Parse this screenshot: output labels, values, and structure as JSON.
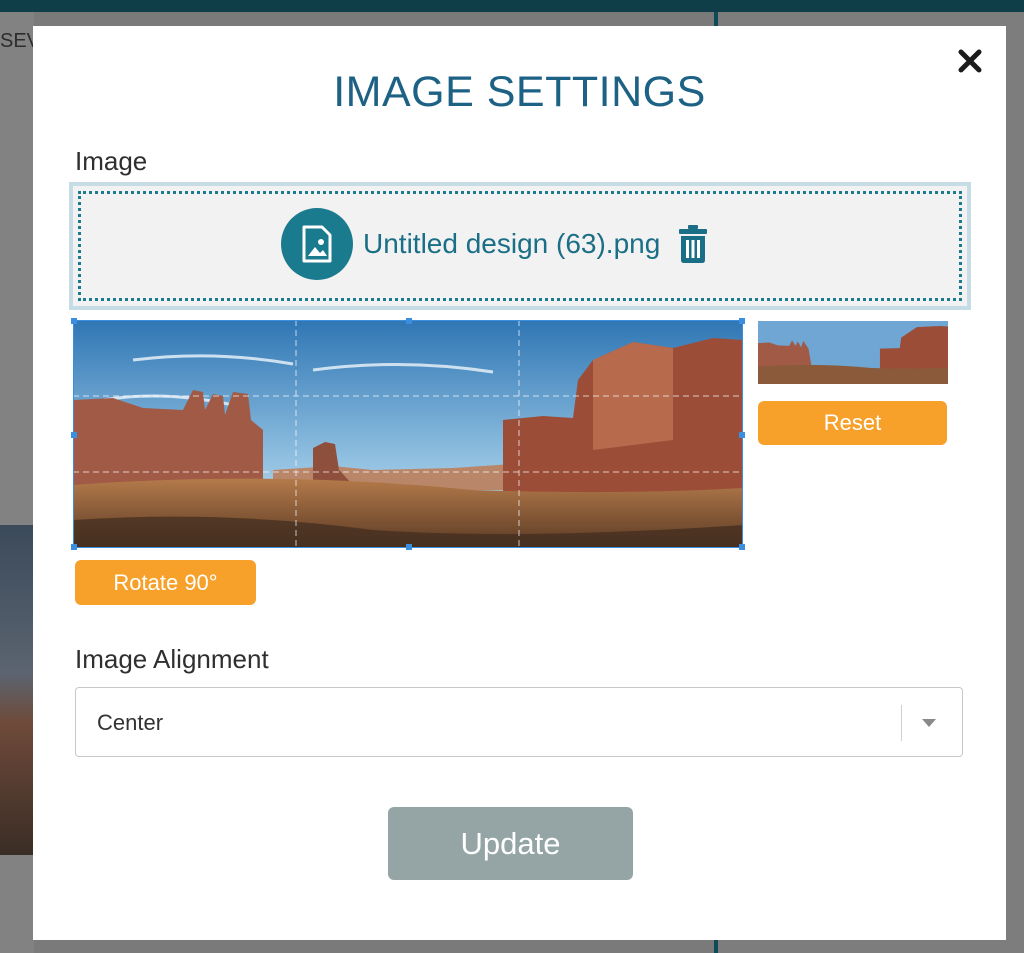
{
  "background": {
    "left_text": "SEV"
  },
  "modal": {
    "title": "IMAGE SETTINGS",
    "close_glyph": "✖",
    "image_label": "Image",
    "file_name": "Untitled design (63).png",
    "rotate_label": "Rotate 90°",
    "reset_label": "Reset",
    "alignment_label": "Image Alignment",
    "alignment_value": "Center",
    "update_label": "Update"
  },
  "colors": {
    "title": "#1d6284",
    "accent_teal": "#1a7a8e",
    "orange": "#f7a02a",
    "update_disabled": "#95a5a6"
  },
  "icons": {
    "close": "close-icon",
    "file": "image-file-icon",
    "delete": "trash-icon",
    "dropdown": "caret-down-icon"
  }
}
